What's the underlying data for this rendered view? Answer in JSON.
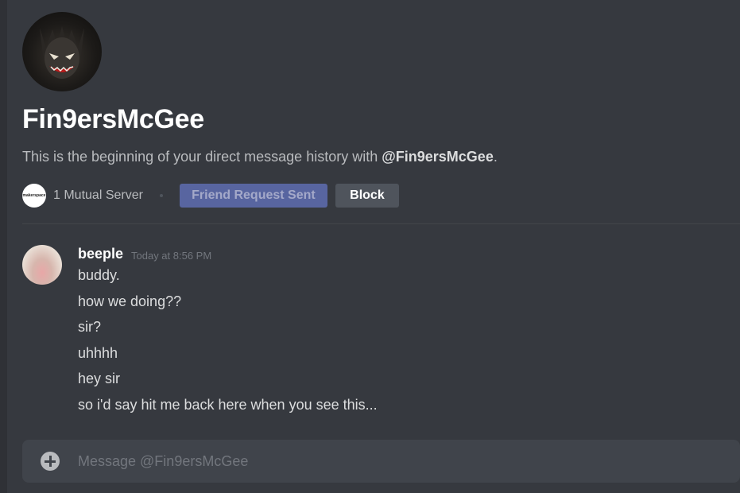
{
  "profile": {
    "username": "Fin9ersMcGee",
    "intro_prefix": "This is the beginning of your direct message history with ",
    "intro_mention": "@Fin9ersMcGee",
    "intro_suffix": ".",
    "server_icon_text": "makerspace",
    "mutual_servers": "1 Mutual Server",
    "friend_request_label": "Friend Request Sent",
    "block_label": "Block"
  },
  "message_group": {
    "author": "beeple",
    "timestamp": "Today at 8:56 PM",
    "messages": [
      "buddy.",
      "how we doing??",
      "sir?",
      "uhhhh",
      "hey sir",
      "so i'd say hit me back here when you see this..."
    ]
  },
  "composer": {
    "placeholder": "Message @Fin9ersMcGee"
  },
  "colors": {
    "background": "#36393f",
    "accent_button": "#5865a0",
    "secondary_button": "#4f545c"
  }
}
